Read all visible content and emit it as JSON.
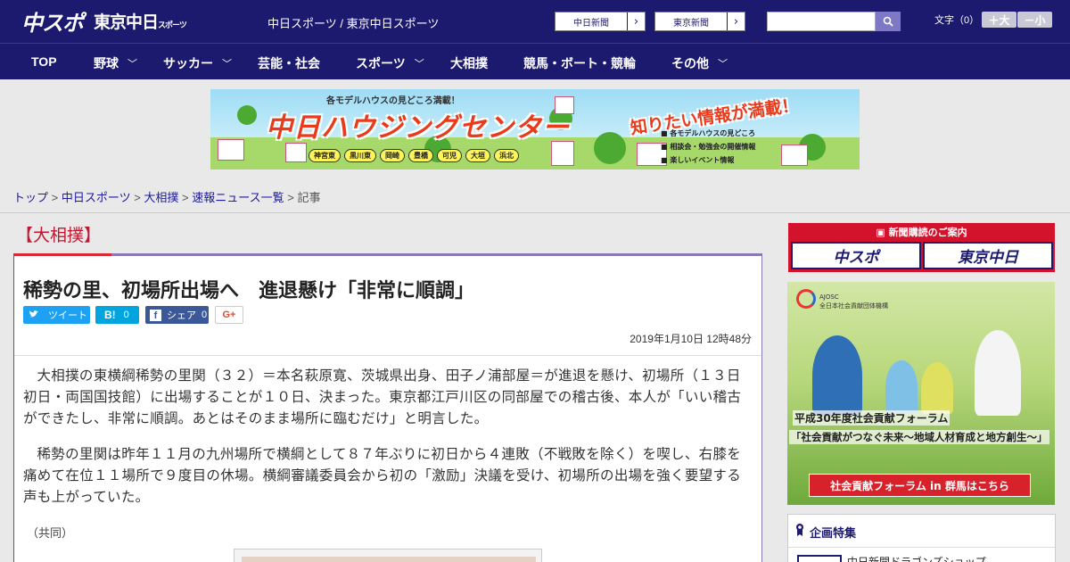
{
  "header": {
    "logo_chusupo": "中スポ",
    "logo_tokyo": "東京中日",
    "logo_tokyo_small": "スポーツ",
    "site_name": "中日スポーツ / 東京中日スポーツ",
    "links": [
      {
        "label": "中日新聞",
        "arrow": "›"
      },
      {
        "label": "東京新聞",
        "arrow": "›"
      }
    ],
    "search_placeholder": "",
    "font_size_label": "文字（0）",
    "font_larger": "＋大",
    "font_smaller": "－小"
  },
  "nav": {
    "items": [
      {
        "label": "TOP",
        "chevron": ""
      },
      {
        "label": "野球",
        "chevron": "﹀"
      },
      {
        "label": "サッカー",
        "chevron": "﹀"
      },
      {
        "label": "芸能・社会",
        "chevron": ""
      },
      {
        "label": "スポーツ",
        "chevron": "﹀"
      },
      {
        "label": "大相撲",
        "chevron": ""
      },
      {
        "label": "競馬・ボート・競輪",
        "chevron": ""
      },
      {
        "label": "その他",
        "chevron": "﹀"
      }
    ]
  },
  "banner": {
    "sub": "各モデルハウスの見どころ満載！",
    "main": "中日ハウジングセンター",
    "catch": "知りたい情報が満載！",
    "areas": [
      "神宮東",
      "黒川東",
      "岡崎",
      "豊橋",
      "可児",
      "大垣",
      "浜北"
    ],
    "info": [
      "■ 各モデルハウスの見どころ",
      "■ 相談会・勉強会の開催情報",
      "■ 楽しいイベント情報"
    ]
  },
  "breadcrumb": {
    "items": [
      "トップ",
      "中日スポーツ",
      "大相撲",
      "速報ニュース一覧"
    ],
    "separator": " > ",
    "current": "記事"
  },
  "article": {
    "category": "【大相撲】",
    "headline": "稀勢の里、初場所出場へ　進退懸け「非常に順調」",
    "share": {
      "tweet": "ツイート",
      "hatena_label": "B!",
      "hatena_count": "0",
      "facebook_label": "シェア",
      "facebook_count": "0",
      "gplus": "G+"
    },
    "date": "2019年1月10日 12時48分",
    "paragraphs": [
      "大相撲の東横綱稀勢の里関（３２）＝本名萩原寛、茨城県出身、田子ノ浦部屋＝が進退を懸け、初場所（１３日初日・両国国技館）に出場することが１０日、決まった。東京都江戸川区の同部屋での稽古後、本人が「いい稽古ができたし、非常に順調。あとはそのまま場所に臨むだけ」と明言した。",
      "稀勢の里関は昨年１１月の九州場所で横綱として８７年ぶりに初日から４連敗（不戦敗を除く）を喫し、右膝を痛めて在位１１場所で９度目の休場。横綱審議委員会から初の「激励」決議を受け、初場所の出場を強く要望する声も上がっていた。"
    ],
    "credit": "（共同）"
  },
  "sidebar": {
    "subscribe_title": "新聞購読のご案内",
    "subscribe_a": "中スポ",
    "subscribe_b": "東京中日",
    "forum_org": [
      "AJOSC",
      "全日本社会貢献団体機構"
    ],
    "forum_line1": "平成30年度社会貢献フォーラム",
    "forum_line2": "「社会貢献がつなぐ未来～地域人材育成と地方創生～」",
    "forum_button": "社会貢献フォーラム in 群馬はこちら",
    "feature_title": "企画特集",
    "feature_item": "中日新聞ドラゴンズショップ"
  },
  "colors": {
    "navy": "#1c1a6f",
    "accent_red": "#c2172f",
    "twitter": "#1da1f2",
    "hatena": "#00a4de",
    "facebook": "#3b5998"
  }
}
